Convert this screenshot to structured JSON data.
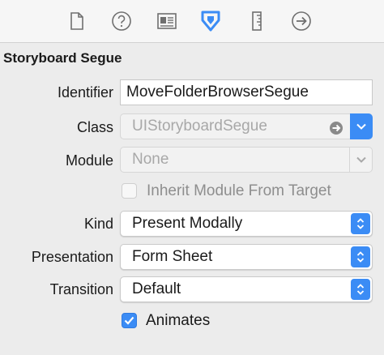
{
  "toolbar": {
    "icons": [
      "file-inspector-icon",
      "quick-help-icon",
      "identity-inspector-icon",
      "attributes-inspector-icon",
      "size-inspector-icon",
      "connections-inspector-icon"
    ],
    "accent": "#3b8cf5"
  },
  "section": {
    "title": "Storyboard Segue"
  },
  "identifier": {
    "label": "Identifier",
    "value": "MoveFolderBrowserSegue"
  },
  "class": {
    "label": "Class",
    "placeholder": "UIStoryboardSegue"
  },
  "module": {
    "label": "Module",
    "placeholder": "None"
  },
  "inherit": {
    "label": "Inherit Module From Target",
    "checked": false
  },
  "kind": {
    "label": "Kind",
    "value": "Present Modally"
  },
  "presentation": {
    "label": "Presentation",
    "value": "Form Sheet"
  },
  "transition": {
    "label": "Transition",
    "value": "Default"
  },
  "animates": {
    "label": "Animates",
    "checked": true
  }
}
